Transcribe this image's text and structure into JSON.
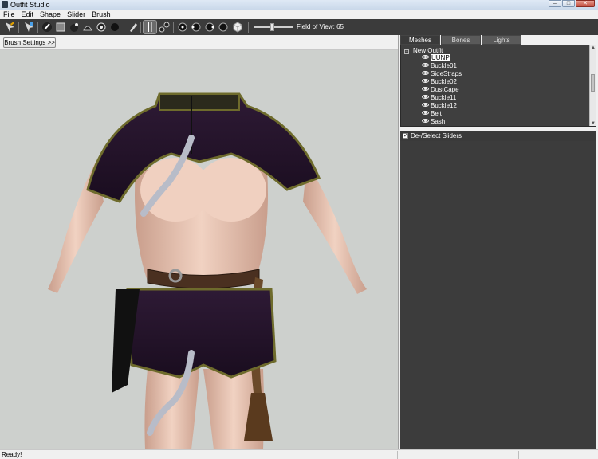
{
  "window": {
    "title": "Outfit Studio",
    "minimize": "–",
    "maximize": "□",
    "close": "✕"
  },
  "menu": [
    "File",
    "Edit",
    "Shape",
    "Slider",
    "Brush"
  ],
  "toolbar": {
    "field_of_view_label": "Field of View: 65",
    "field_of_view_level": 0.45,
    "icons": [
      "select-brush-icon",
      "transform-brush-icon",
      "mask-brush-icon",
      "inflate-brush-icon",
      "deflate-brush-icon",
      "move-brush-icon",
      "smooth-brush-icon",
      "weight-brush-icon",
      "color-brush-icon",
      "edit-pivot-icon",
      "view-front-icon",
      "view-left-icon",
      "view-right-icon",
      "view-back-icon",
      "view-perspective-icon"
    ]
  },
  "brush_settings_button": "Brush Settings >>",
  "tabs": [
    "Meshes",
    "Bones",
    "Lights"
  ],
  "selected_tab": "Meshes",
  "tree": {
    "root": "New Outfit",
    "items": [
      "UUNP",
      "Buckle01",
      "SideStraps",
      "Buckle02",
      "DustCape",
      "Buckle11",
      "Buckle12",
      "Belt",
      "Sash"
    ],
    "selected": "UUNP"
  },
  "sliders_toggle_label": "De-/Select Sliders",
  "status": "Ready!",
  "colors": {
    "viewport_bg": "#cdd0cd",
    "panel_dark": "#3f3f3f",
    "toolbar_bg": "#3b3b3b",
    "outfit_purple": "#2a1630",
    "outfit_trim": "#7a7430",
    "skin": "#e8c3b0"
  }
}
